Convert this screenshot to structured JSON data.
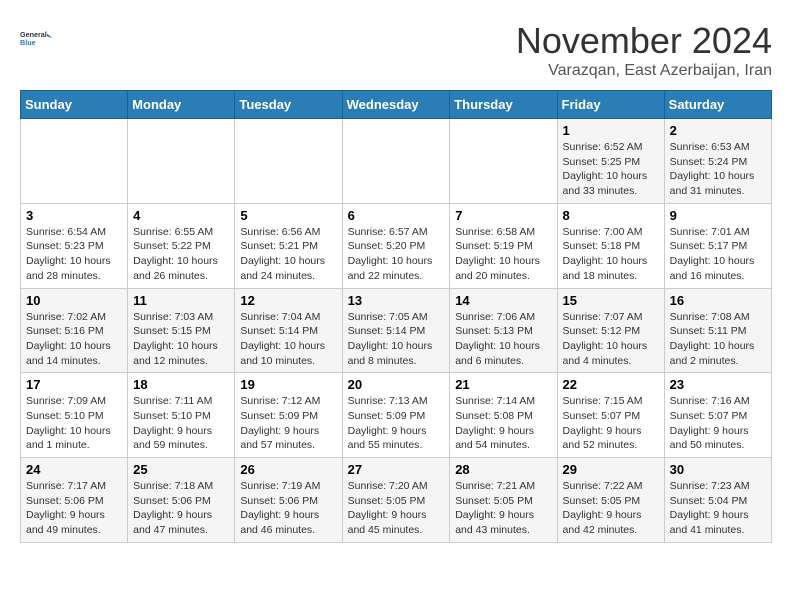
{
  "header": {
    "logo_line1": "General",
    "logo_line2": "Blue",
    "month_title": "November 2024",
    "location": "Varazqan, East Azerbaijan, Iran"
  },
  "days_of_week": [
    "Sunday",
    "Monday",
    "Tuesday",
    "Wednesday",
    "Thursday",
    "Friday",
    "Saturday"
  ],
  "weeks": [
    [
      {
        "day": "",
        "info": ""
      },
      {
        "day": "",
        "info": ""
      },
      {
        "day": "",
        "info": ""
      },
      {
        "day": "",
        "info": ""
      },
      {
        "day": "",
        "info": ""
      },
      {
        "day": "1",
        "info": "Sunrise: 6:52 AM\nSunset: 5:25 PM\nDaylight: 10 hours and 33 minutes."
      },
      {
        "day": "2",
        "info": "Sunrise: 6:53 AM\nSunset: 5:24 PM\nDaylight: 10 hours and 31 minutes."
      }
    ],
    [
      {
        "day": "3",
        "info": "Sunrise: 6:54 AM\nSunset: 5:23 PM\nDaylight: 10 hours and 28 minutes."
      },
      {
        "day": "4",
        "info": "Sunrise: 6:55 AM\nSunset: 5:22 PM\nDaylight: 10 hours and 26 minutes."
      },
      {
        "day": "5",
        "info": "Sunrise: 6:56 AM\nSunset: 5:21 PM\nDaylight: 10 hours and 24 minutes."
      },
      {
        "day": "6",
        "info": "Sunrise: 6:57 AM\nSunset: 5:20 PM\nDaylight: 10 hours and 22 minutes."
      },
      {
        "day": "7",
        "info": "Sunrise: 6:58 AM\nSunset: 5:19 PM\nDaylight: 10 hours and 20 minutes."
      },
      {
        "day": "8",
        "info": "Sunrise: 7:00 AM\nSunset: 5:18 PM\nDaylight: 10 hours and 18 minutes."
      },
      {
        "day": "9",
        "info": "Sunrise: 7:01 AM\nSunset: 5:17 PM\nDaylight: 10 hours and 16 minutes."
      }
    ],
    [
      {
        "day": "10",
        "info": "Sunrise: 7:02 AM\nSunset: 5:16 PM\nDaylight: 10 hours and 14 minutes."
      },
      {
        "day": "11",
        "info": "Sunrise: 7:03 AM\nSunset: 5:15 PM\nDaylight: 10 hours and 12 minutes."
      },
      {
        "day": "12",
        "info": "Sunrise: 7:04 AM\nSunset: 5:14 PM\nDaylight: 10 hours and 10 minutes."
      },
      {
        "day": "13",
        "info": "Sunrise: 7:05 AM\nSunset: 5:14 PM\nDaylight: 10 hours and 8 minutes."
      },
      {
        "day": "14",
        "info": "Sunrise: 7:06 AM\nSunset: 5:13 PM\nDaylight: 10 hours and 6 minutes."
      },
      {
        "day": "15",
        "info": "Sunrise: 7:07 AM\nSunset: 5:12 PM\nDaylight: 10 hours and 4 minutes."
      },
      {
        "day": "16",
        "info": "Sunrise: 7:08 AM\nSunset: 5:11 PM\nDaylight: 10 hours and 2 minutes."
      }
    ],
    [
      {
        "day": "17",
        "info": "Sunrise: 7:09 AM\nSunset: 5:10 PM\nDaylight: 10 hours and 1 minute."
      },
      {
        "day": "18",
        "info": "Sunrise: 7:11 AM\nSunset: 5:10 PM\nDaylight: 9 hours and 59 minutes."
      },
      {
        "day": "19",
        "info": "Sunrise: 7:12 AM\nSunset: 5:09 PM\nDaylight: 9 hours and 57 minutes."
      },
      {
        "day": "20",
        "info": "Sunrise: 7:13 AM\nSunset: 5:09 PM\nDaylight: 9 hours and 55 minutes."
      },
      {
        "day": "21",
        "info": "Sunrise: 7:14 AM\nSunset: 5:08 PM\nDaylight: 9 hours and 54 minutes."
      },
      {
        "day": "22",
        "info": "Sunrise: 7:15 AM\nSunset: 5:07 PM\nDaylight: 9 hours and 52 minutes."
      },
      {
        "day": "23",
        "info": "Sunrise: 7:16 AM\nSunset: 5:07 PM\nDaylight: 9 hours and 50 minutes."
      }
    ],
    [
      {
        "day": "24",
        "info": "Sunrise: 7:17 AM\nSunset: 5:06 PM\nDaylight: 9 hours and 49 minutes."
      },
      {
        "day": "25",
        "info": "Sunrise: 7:18 AM\nSunset: 5:06 PM\nDaylight: 9 hours and 47 minutes."
      },
      {
        "day": "26",
        "info": "Sunrise: 7:19 AM\nSunset: 5:06 PM\nDaylight: 9 hours and 46 minutes."
      },
      {
        "day": "27",
        "info": "Sunrise: 7:20 AM\nSunset: 5:05 PM\nDaylight: 9 hours and 45 minutes."
      },
      {
        "day": "28",
        "info": "Sunrise: 7:21 AM\nSunset: 5:05 PM\nDaylight: 9 hours and 43 minutes."
      },
      {
        "day": "29",
        "info": "Sunrise: 7:22 AM\nSunset: 5:05 PM\nDaylight: 9 hours and 42 minutes."
      },
      {
        "day": "30",
        "info": "Sunrise: 7:23 AM\nSunset: 5:04 PM\nDaylight: 9 hours and 41 minutes."
      }
    ]
  ]
}
